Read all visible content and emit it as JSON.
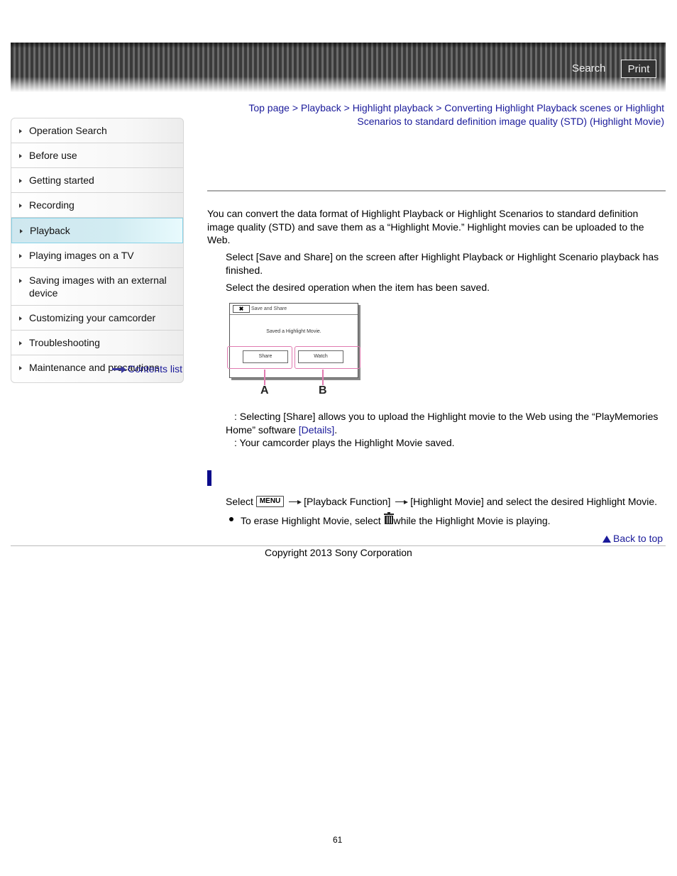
{
  "header": {
    "search_label": "Search",
    "print_label": "Print"
  },
  "sidebar": {
    "items": [
      {
        "label": "Operation Search",
        "active": false
      },
      {
        "label": "Before use",
        "active": false
      },
      {
        "label": "Getting started",
        "active": false
      },
      {
        "label": "Recording",
        "active": false
      },
      {
        "label": "Playback",
        "active": true
      },
      {
        "label": "Playing images on a TV",
        "active": false
      },
      {
        "label": "Saving images with an external device",
        "active": false
      },
      {
        "label": "Customizing your camcorder",
        "active": false
      },
      {
        "label": "Troubleshooting",
        "active": false
      },
      {
        "label": "Maintenance and precautions",
        "active": false
      }
    ],
    "contents_list_label": "Contents list"
  },
  "breadcrumb": {
    "items": [
      "Top page",
      "Playback",
      "Highlight playback",
      "Converting Highlight Playback scenes or Highlight Scenarios to standard definition image quality (STD) (Highlight Movie)"
    ],
    "separator": ">"
  },
  "content": {
    "intro": "You can convert the data format of Highlight Playback or Highlight Scenarios to standard definition image quality (STD) and save them as a “Highlight Movie.” Highlight movies can be uploaded to the Web.",
    "step1": "Select [Save and Share] on the screen after Highlight Playback or Highlight Scenario playback has finished.",
    "step2": "Select the desired operation when the item has been saved.",
    "figure": {
      "close_glyph": "✖",
      "title": "Save and Share",
      "message": "Saved a Highlight Movie.",
      "button_a": "Share",
      "button_b": "Watch",
      "label_a": "A",
      "label_b": "B",
      "highlight_color": "#e07ab0"
    },
    "desc_a_prefix": ": Selecting [Share] allows you to upload the Highlight movie to the Web using the “PlayMemories Home” software ",
    "desc_a_link": "[Details]",
    "desc_a_suffix": ".",
    "desc_b": ": Your camcorder plays the Highlight Movie saved.",
    "menu_step": {
      "prefix": "Select",
      "menu_label": "MENU",
      "item1": "[Playback Function]",
      "item2": "[Highlight Movie] and select the desired Highlight Movie."
    },
    "note": {
      "prefix": "To erase Highlight Movie, select",
      "suffix": "while the Highlight Movie is playing."
    }
  },
  "footer": {
    "back_to_top": "Back to top",
    "copyright": "Copyright 2013 Sony Corporation",
    "page_number": "61"
  },
  "colors": {
    "link": "#1a1a9a",
    "section_bar": "#0a0a8a",
    "active_item_bg": "#d2ecf2"
  }
}
